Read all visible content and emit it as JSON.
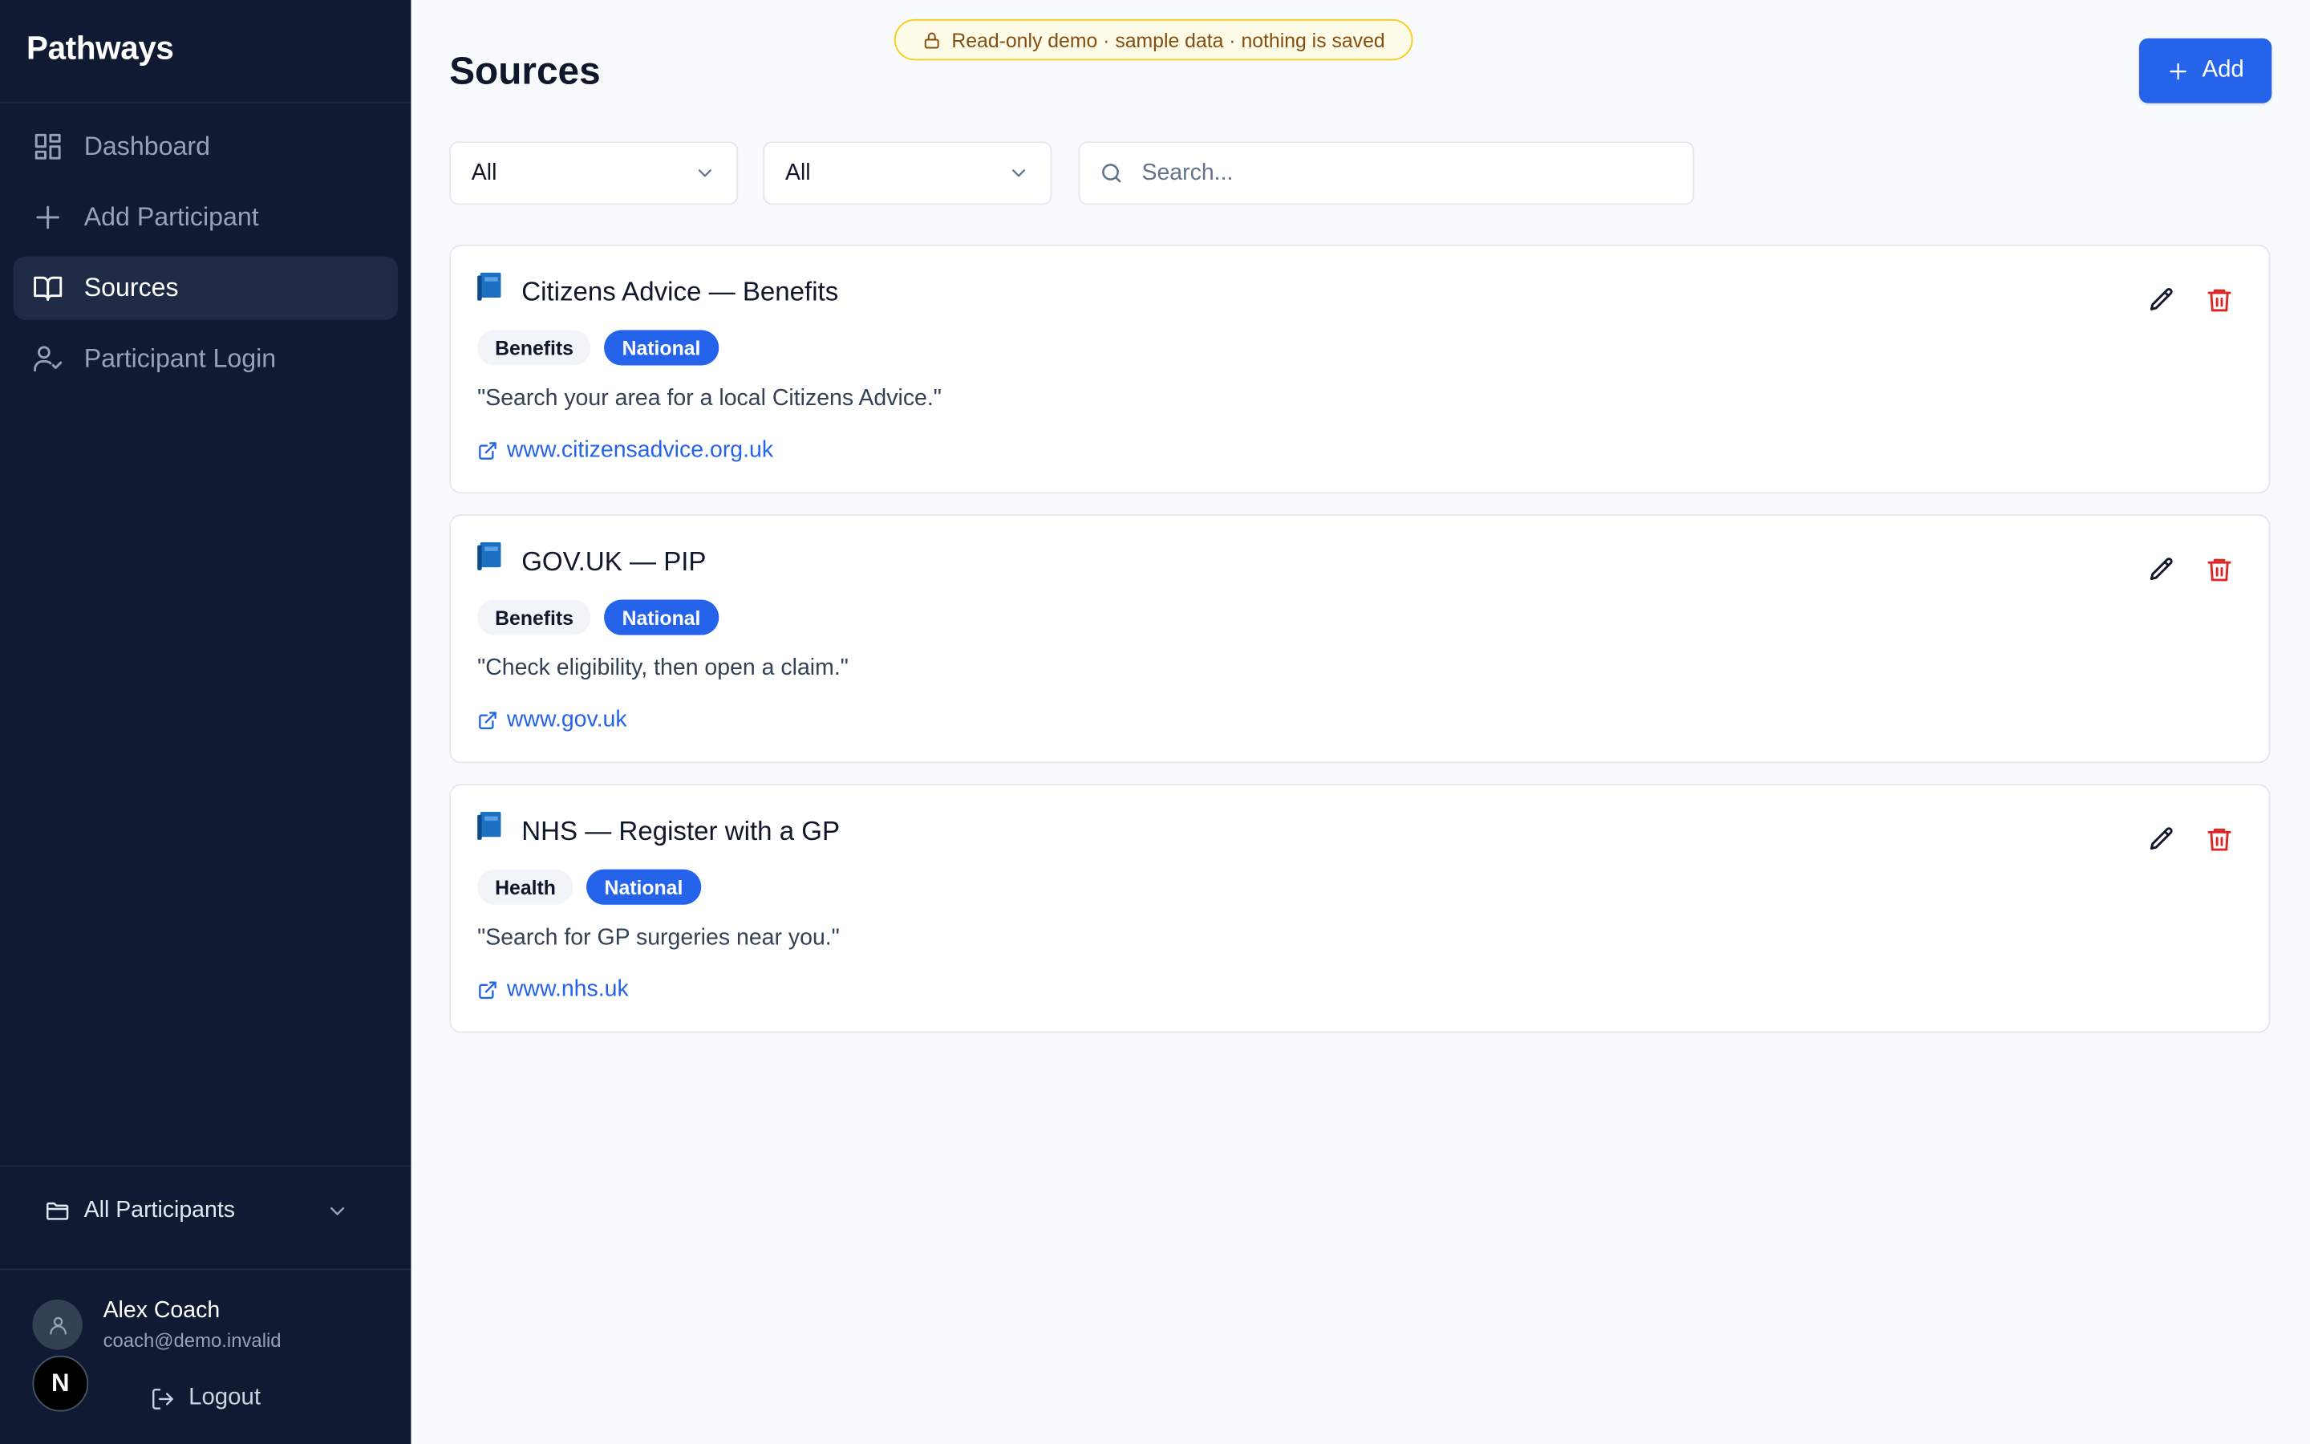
{
  "app": {
    "brand": "Pathways"
  },
  "sidebar": {
    "items": [
      {
        "label": "Dashboard",
        "icon": "dashboard-icon",
        "active": false
      },
      {
        "label": "Add Participant",
        "icon": "plus-icon",
        "active": false
      },
      {
        "label": "Sources",
        "icon": "book-open-icon",
        "active": true
      },
      {
        "label": "Participant Login",
        "icon": "user-check-icon",
        "active": false
      }
    ],
    "project": {
      "label": "All Participants",
      "icon": "folder-icon"
    },
    "user": {
      "name": "Alex Coach",
      "email": "coach@demo.invalid",
      "badge": "N"
    },
    "logout_label": "Logout"
  },
  "banner": {
    "text": "Read-only demo · sample data · nothing is saved",
    "icon": "lock-icon"
  },
  "page": {
    "title": "Sources",
    "add_label": "Add"
  },
  "filters": {
    "category": {
      "value": "All"
    },
    "scope": {
      "value": "All"
    },
    "search_placeholder": "Search..."
  },
  "sources": [
    {
      "title": "Citizens Advice — Benefits",
      "category": "Benefits",
      "scope": "National",
      "description": "\"Search your area for a local Citizens Advice.\"",
      "url": "www.citizensadvice.org.uk"
    },
    {
      "title": "GOV.UK — PIP",
      "category": "Benefits",
      "scope": "National",
      "description": "\"Check eligibility, then open a claim.\"",
      "url": "www.gov.uk"
    },
    {
      "title": "NHS — Register with a GP",
      "category": "Health",
      "scope": "National",
      "description": "\"Search for GP surgeries near you.\"",
      "url": "www.nhs.uk"
    }
  ],
  "colors": {
    "sidebar_bg": "#101a33",
    "accent": "#2563eb",
    "danger": "#dc2626",
    "banner_border": "#facc15"
  }
}
